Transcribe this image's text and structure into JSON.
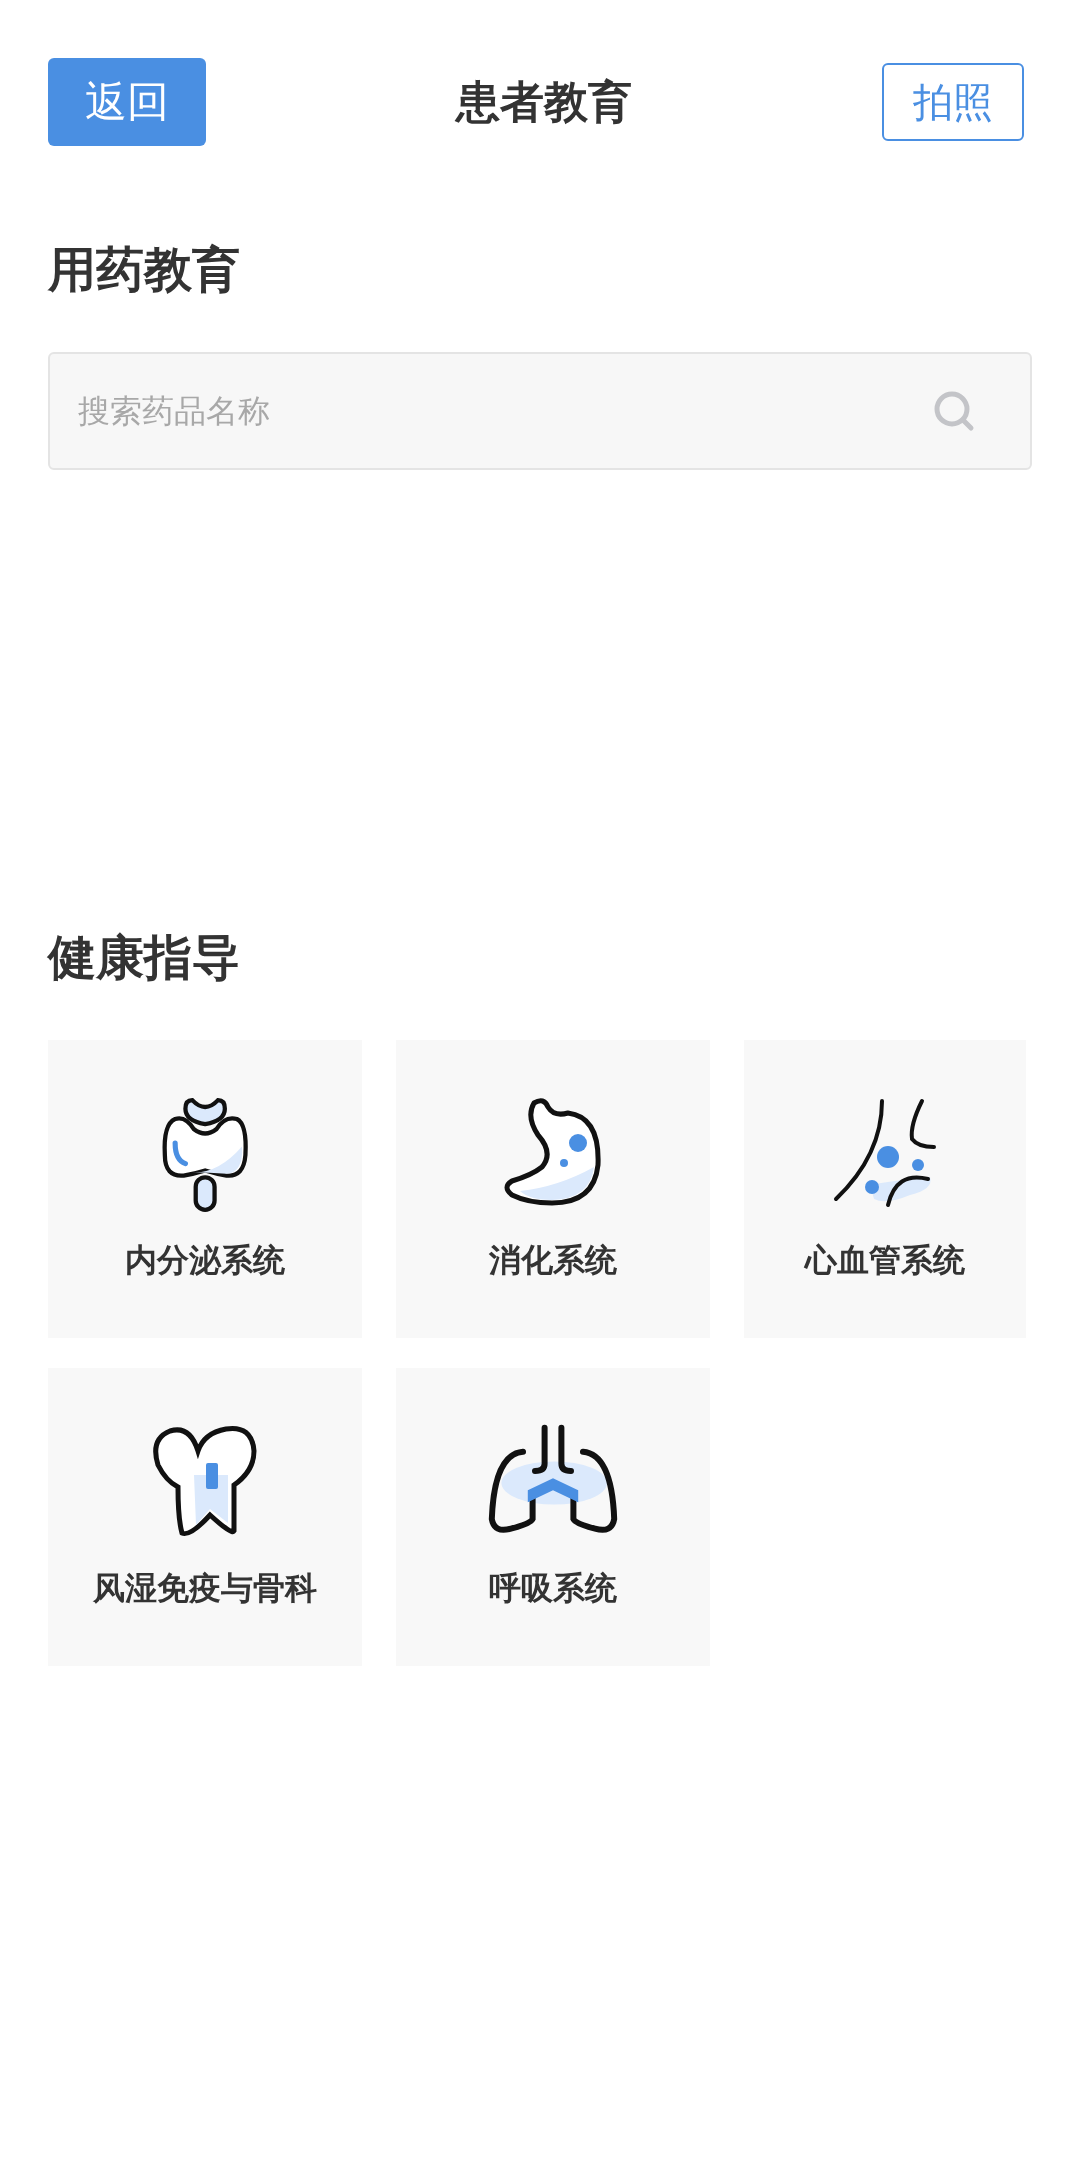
{
  "header": {
    "back_button": "返回",
    "title": "患者教育",
    "photo_button": "拍照"
  },
  "medication": {
    "title": "用药教育",
    "search": {
      "placeholder": "搜索药品名称"
    }
  },
  "guidance": {
    "title": "健康指导",
    "cards": [
      {
        "label": "内分泌系统"
      },
      {
        "label": "消化系统"
      },
      {
        "label": "心血管系统"
      },
      {
        "label": "风湿免疫与骨科"
      },
      {
        "label": "呼吸系统"
      }
    ]
  }
}
